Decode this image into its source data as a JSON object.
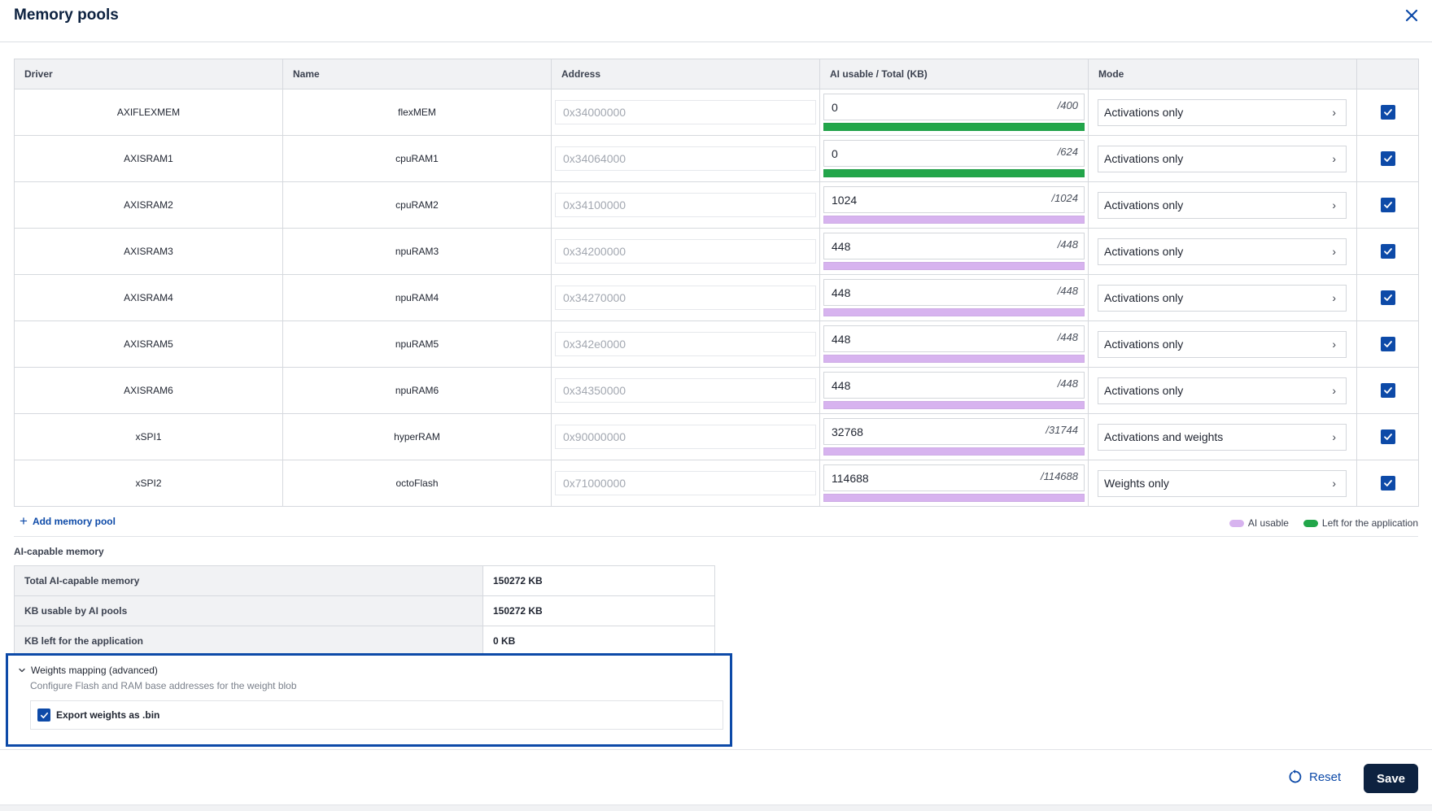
{
  "header": {
    "title": "Memory pools"
  },
  "colors": {
    "ai_usable": "#d7b3ef",
    "left_for_app": "#22a64a",
    "accent": "#0d4aa8",
    "save_bg": "#0d2240"
  },
  "table": {
    "headers": {
      "driver": "Driver",
      "name": "Name",
      "address": "Address",
      "usage": "AI usable / Total (KB)",
      "mode": "Mode"
    },
    "rows": [
      {
        "driver": "AXIFLEXMEM",
        "name": "flexMEM",
        "address": "0x34000000",
        "usable": "0",
        "total": "/400",
        "bar": "left",
        "mode": "Activations only",
        "enabled": true
      },
      {
        "driver": "AXISRAM1",
        "name": "cpuRAM1",
        "address": "0x34064000",
        "usable": "0",
        "total": "/624",
        "bar": "left",
        "mode": "Activations only",
        "enabled": true
      },
      {
        "driver": "AXISRAM2",
        "name": "cpuRAM2",
        "address": "0x34100000",
        "usable": "1024",
        "total": "/1024",
        "bar": "ai",
        "mode": "Activations only",
        "enabled": true
      },
      {
        "driver": "AXISRAM3",
        "name": "npuRAM3",
        "address": "0x34200000",
        "usable": "448",
        "total": "/448",
        "bar": "ai",
        "mode": "Activations only",
        "enabled": true
      },
      {
        "driver": "AXISRAM4",
        "name": "npuRAM4",
        "address": "0x34270000",
        "usable": "448",
        "total": "/448",
        "bar": "ai",
        "mode": "Activations only",
        "enabled": true
      },
      {
        "driver": "AXISRAM5",
        "name": "npuRAM5",
        "address": "0x342e0000",
        "usable": "448",
        "total": "/448",
        "bar": "ai",
        "mode": "Activations only",
        "enabled": true
      },
      {
        "driver": "AXISRAM6",
        "name": "npuRAM6",
        "address": "0x34350000",
        "usable": "448",
        "total": "/448",
        "bar": "ai",
        "mode": "Activations only",
        "enabled": true
      },
      {
        "driver": "xSPI1",
        "name": "hyperRAM",
        "address": "0x90000000",
        "usable": "32768",
        "total": "/31744",
        "bar": "ai",
        "mode": "Activations and weights",
        "enabled": true
      },
      {
        "driver": "xSPI2",
        "name": "octoFlash",
        "address": "0x71000000",
        "usable": "114688",
        "total": "/114688",
        "bar": "ai",
        "mode": "Weights only",
        "enabled": true
      }
    ]
  },
  "add_pool_label": "Add memory pool",
  "legend": {
    "ai_usable": "AI usable",
    "left_for_app": "Left for the application"
  },
  "summary": {
    "title": "AI-capable memory",
    "rows": [
      {
        "label": "Total AI-capable memory",
        "value": "150272 KB"
      },
      {
        "label": "KB usable by AI pools",
        "value": "150272 KB"
      },
      {
        "label": "KB left for the application",
        "value": "0 KB"
      }
    ]
  },
  "weights": {
    "title": "Weights mapping (advanced)",
    "description": "Configure Flash and RAM base addresses for the weight blob",
    "export_label": "Export weights as .bin",
    "export_checked": true
  },
  "footer": {
    "reset_label": "Reset",
    "save_label": "Save"
  }
}
